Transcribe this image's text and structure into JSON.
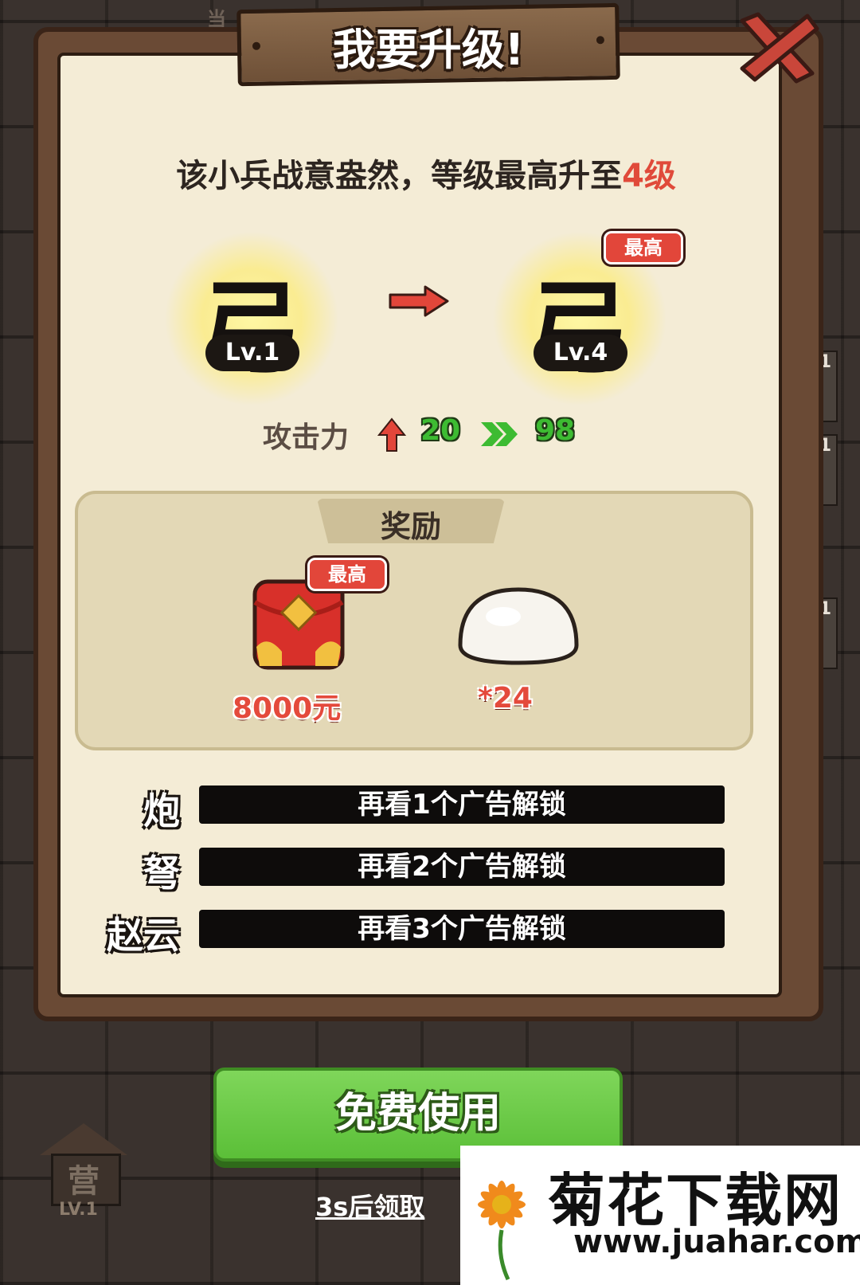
{
  "top_hint": "当",
  "title": "我要升级!",
  "description": {
    "prefix": "该小兵战意盎然，等级最高升至",
    "highlight": "4级"
  },
  "units": {
    "current": {
      "char": "弓",
      "level": "Lv.1"
    },
    "upgraded": {
      "char": "弓",
      "level": "Lv.4",
      "badge": "最高"
    }
  },
  "stat": {
    "label": "攻击力",
    "from": "20",
    "to": "98"
  },
  "rewards": {
    "title": "奖励",
    "items": [
      {
        "icon": "red-envelope-icon",
        "value": "8000元",
        "badge": "最高"
      },
      {
        "icon": "steamed-bun-icon",
        "value": "*24"
      }
    ]
  },
  "unlocks": [
    {
      "name": "炮",
      "text": "再看1个广告解锁"
    },
    {
      "name": "弩",
      "text": "再看2个广告解锁"
    },
    {
      "name": "赵云",
      "text": "再看3个广告解锁"
    }
  ],
  "free_button": "免费使用",
  "claim_text": "3s后领取",
  "camp": {
    "char": "营",
    "level": "LV.1"
  },
  "side_tiles": [
    "1",
    "1",
    "1"
  ],
  "watermark": {
    "title": "菊花下载网",
    "url": "www.juahar.com"
  },
  "colors": {
    "accent_red": "#e04a3a",
    "stat_green": "#3dbb32",
    "button_green": "#5bbf38"
  }
}
